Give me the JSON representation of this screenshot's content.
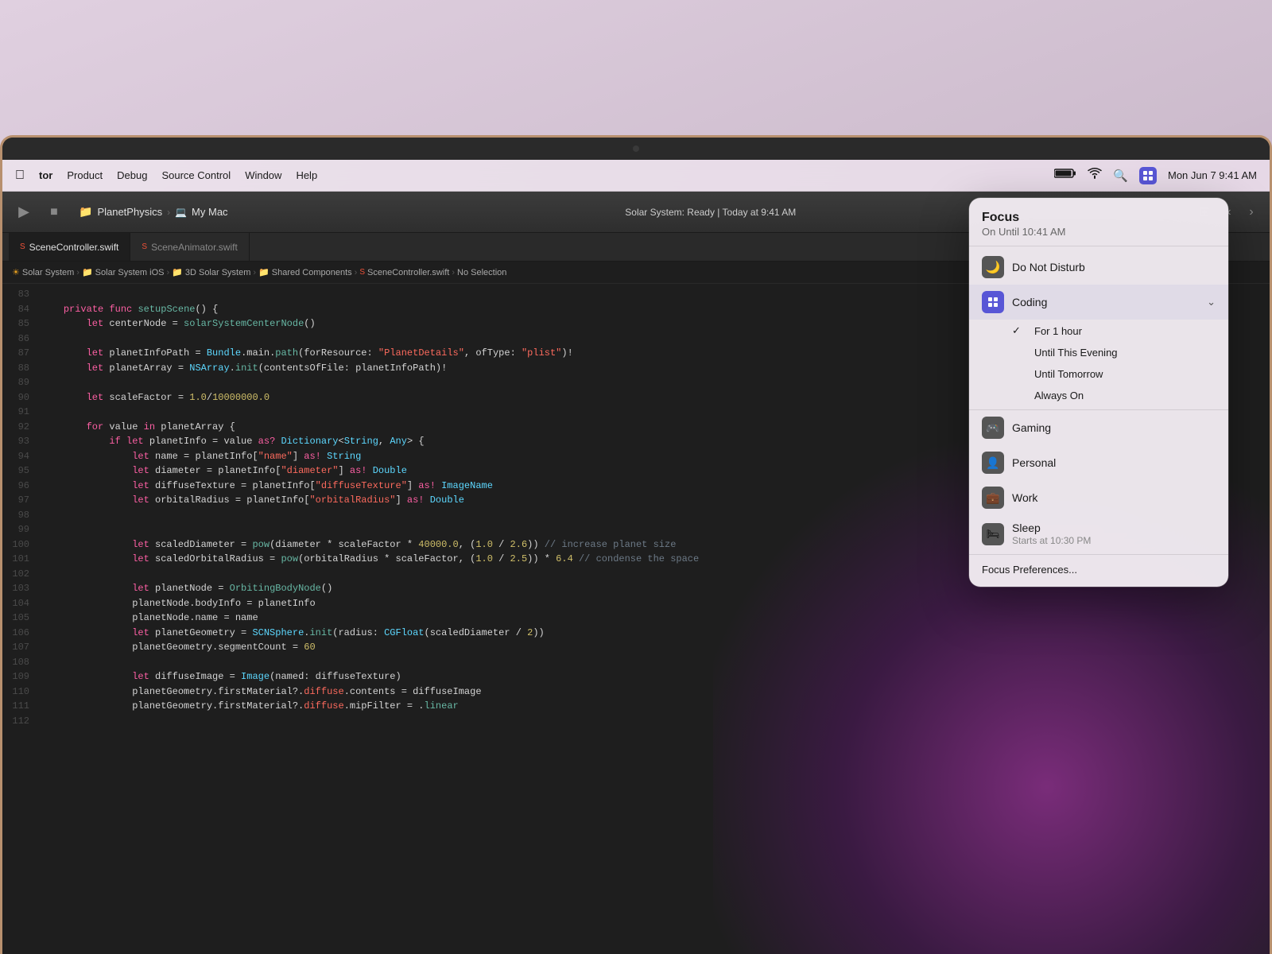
{
  "menubar": {
    "items": [
      "tor",
      "Product",
      "Debug",
      "Source Control",
      "Window",
      "Help"
    ],
    "time": "Mon Jun 7  9:41 AM"
  },
  "toolbar": {
    "project_name": "PlanetPhysics",
    "my_mac": "My Mac",
    "status": "Solar System: Ready | Today at 9:41 AM"
  },
  "tabs": [
    {
      "label": "SceneController.swift",
      "active": true
    },
    {
      "label": "SceneAnimator.swift",
      "active": false
    }
  ],
  "breadcrumb": {
    "parts": [
      "Solar System",
      "Solar System iOS",
      "3D Solar System",
      "Shared Components",
      "SceneController.swift",
      "No Selection"
    ]
  },
  "code_lines": [
    {
      "num": "83",
      "content": ""
    },
    {
      "num": "84",
      "content": "    private func setupScene() {"
    },
    {
      "num": "85",
      "content": "        let centerNode = solarSystemCenterNode()"
    },
    {
      "num": "86",
      "content": ""
    },
    {
      "num": "87",
      "content": "        let planetInfoPath = Bundle.main.path(forResource: \"PlanetDetails\", ofType: \"plist\")!"
    },
    {
      "num": "88",
      "content": "        let planetArray = NSArray.init(contentsOfFile: planetInfoPath)!"
    },
    {
      "num": "89",
      "content": ""
    },
    {
      "num": "90",
      "content": "        let scaleFactor = 1.0/10000000.0"
    },
    {
      "num": "91",
      "content": ""
    },
    {
      "num": "92",
      "content": "        for value in planetArray {"
    },
    {
      "num": "93",
      "content": "            if let planetInfo = value as? Dictionary<String, Any> {"
    },
    {
      "num": "94",
      "content": "                let name = planetInfo[\"name\"] as! String"
    },
    {
      "num": "95",
      "content": "                let diameter = planetInfo[\"diameter\"] as! Double"
    },
    {
      "num": "96",
      "content": "                let diffuseTexture = planetInfo[\"diffuseTexture\"] as! ImageName"
    },
    {
      "num": "97",
      "content": "                let orbitalRadius = planetInfo[\"orbitalRadius\"] as! Double"
    },
    {
      "num": "98",
      "content": ""
    },
    {
      "num": "99",
      "content": ""
    },
    {
      "num": "100",
      "content": "                let scaledDiameter = pow(diameter * scaleFactor * 40000.0, (1.0 / 2.6)) // increase planet size"
    },
    {
      "num": "101",
      "content": "                let scaledOrbitalRadius = pow(orbitalRadius * scaleFactor, (1.0 / 2.5)) * 6.4 // condense the space"
    },
    {
      "num": "102",
      "content": ""
    },
    {
      "num": "103",
      "content": "                let planetNode = OrbitingBodyNode()"
    },
    {
      "num": "104",
      "content": "                planetNode.bodyInfo = planetInfo"
    },
    {
      "num": "105",
      "content": "                planetNode.name = name"
    },
    {
      "num": "106",
      "content": "                let planetGeometry = SCNSphere.init(radius: CGFloat(scaledDiameter / 2))"
    },
    {
      "num": "107",
      "content": "                planetGeometry.segmentCount = 60"
    },
    {
      "num": "108",
      "content": ""
    },
    {
      "num": "109",
      "content": "                let diffuseImage = Image(named: diffuseTexture)"
    },
    {
      "num": "110",
      "content": "                planetGeometry.firstMaterial?.diffuse.contents = diffuseImage"
    },
    {
      "num": "111",
      "content": "                planetGeometry.firstMaterial?.diffuse.mipFilter = .linear"
    },
    {
      "num": "112",
      "content": ""
    }
  ],
  "focus_panel": {
    "title": "Focus",
    "subtitle": "On Until 10:41 AM",
    "items": [
      {
        "id": "dnd",
        "label": "Do Not Disturb",
        "icon": "🌙",
        "icon_class": "dnd"
      },
      {
        "id": "coding",
        "label": "Coding",
        "icon": "⊞",
        "icon_class": "coding",
        "expanded": true
      },
      {
        "id": "gaming",
        "label": "Gaming",
        "icon": "🎮",
        "icon_class": "gaming"
      },
      {
        "id": "personal",
        "label": "Personal",
        "icon": "👤",
        "icon_class": "personal"
      },
      {
        "id": "work",
        "label": "Work",
        "icon": "💼",
        "icon_class": "work"
      },
      {
        "id": "sleep",
        "label": "Sleep",
        "sublabel": "Starts at 10:30 PM",
        "icon": "🛏",
        "icon_class": "sleep"
      }
    ],
    "coding_submenu": [
      {
        "label": "For 1 hour",
        "checked": true
      },
      {
        "label": "Until This Evening",
        "checked": false
      },
      {
        "label": "Until Tomorrow",
        "checked": false
      },
      {
        "label": "Always On",
        "checked": false
      }
    ],
    "preferences_label": "Focus Preferences..."
  }
}
